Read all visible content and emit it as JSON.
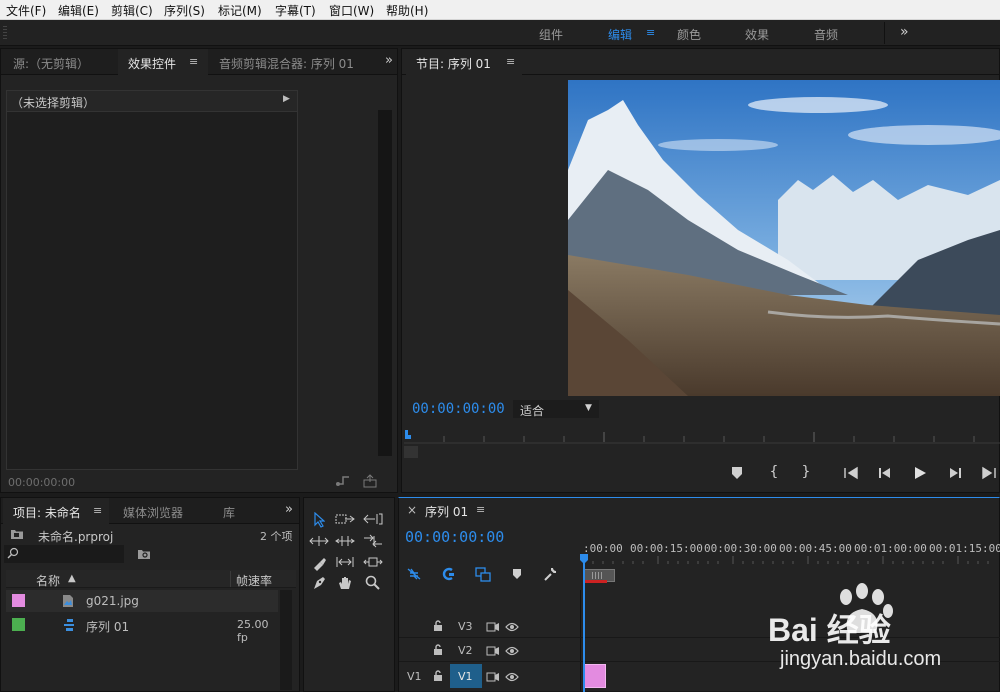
{
  "menubar": {
    "items": [
      "文件(F)",
      "编辑(E)",
      "剪辑(C)",
      "序列(S)",
      "标记(M)",
      "字幕(T)",
      "窗口(W)",
      "帮助(H)"
    ]
  },
  "workspaces": {
    "items": [
      "组件",
      "编辑",
      "颜色",
      "效果",
      "音频"
    ],
    "active": "编辑",
    "menu_glyph": "≡",
    "more_glyph": "»"
  },
  "source_panel": {
    "tabs": [
      "源:（无剪辑）",
      "效果控件",
      "音频剪辑混合器: 序列 01"
    ],
    "active_tab": "效果控件",
    "menu_glyph": "≡",
    "more_glyph": "»",
    "header": "（未选择剪辑）",
    "expand_glyph": "▶",
    "timecode": "00:00:00:00"
  },
  "program_monitor": {
    "title": "节目: 序列 01",
    "menu_glyph": "≡",
    "timecode": "00:00:00:00",
    "fit": "适合",
    "dropdown_glyph": "▼",
    "controls": [
      "marker-icon",
      "mark-in-icon",
      "mark-out-icon",
      "go-to-in-icon",
      "step-back-icon",
      "play-icon",
      "step-forward-icon",
      "go-to-out-icon"
    ]
  },
  "project_panel": {
    "tabs": [
      "项目: 未命名",
      "媒体浏览器",
      "库"
    ],
    "active_tab": "项目: 未命名",
    "menu_glyph": "≡",
    "more_glyph": "»",
    "project_file": "未命名.prproj",
    "item_count": "2 个项",
    "search_placeholder": "",
    "columns": [
      "名称",
      "帧速率"
    ],
    "sort_glyph": "▲",
    "items": [
      {
        "name": "g021.jpg",
        "framerate": "",
        "color": "#e38be0",
        "type": "image"
      },
      {
        "name": "序列 01",
        "framerate": "25.00 fp",
        "color": "#4caf50",
        "type": "sequence"
      }
    ]
  },
  "tools": [
    "selection-tool",
    "track-select-tool",
    "ripple-edit-tool",
    "rolling-edit-tool",
    "rate-stretch-tool",
    "razor-tool",
    "slip-tool",
    "slide-tool",
    "pen-tool",
    "hand-tool",
    "zoom-tool"
  ],
  "timeline": {
    "close_glyph": "×",
    "title": "序列 01",
    "menu_glyph": "≡",
    "timecode": "00:00:00:00",
    "ruler": [
      ":00:00",
      "00:00:15:00",
      "00:00:30:00",
      "00:00:45:00",
      "00:01:00:00",
      "00:01:15:00"
    ],
    "tracks": [
      {
        "name": "V3",
        "source": ""
      },
      {
        "name": "V2",
        "source": ""
      },
      {
        "name": "V1",
        "source": "V1"
      }
    ],
    "clip_color": "#e38be0"
  },
  "watermark": {
    "brand": "Bai 经验",
    "url": "jingyan.baidu.com"
  },
  "colors": {
    "accent": "#2d8ceb",
    "panel_bg": "#232323",
    "menubar_bg": "#f0f0f0"
  }
}
